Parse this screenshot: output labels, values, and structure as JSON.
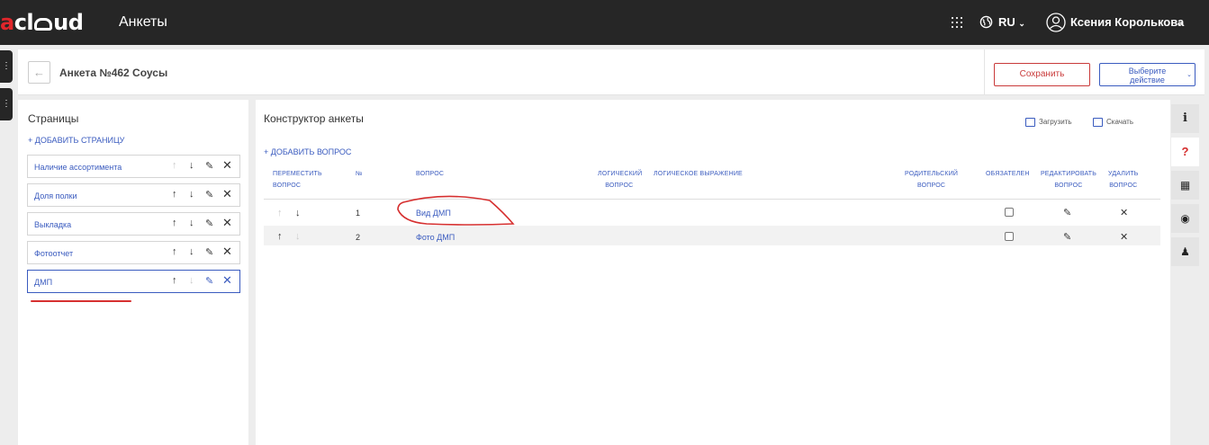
{
  "topbar": {
    "logo_prefix": "a",
    "logo_main": "cl",
    "logo_suffix": "ud",
    "app_title": "Анкеты",
    "lang": "RU",
    "user_name": "Ксения Королькова"
  },
  "header": {
    "form_title": "Анкета №462 Соусы",
    "save_label": "Сохранить",
    "action_label_line1": "Выберите",
    "action_label_line2": "действие"
  },
  "pages": {
    "title": "Страницы",
    "add_label": "+ ДОБАВИТЬ СТРАНИЦУ",
    "items": [
      {
        "label": "Наличие ассортимента"
      },
      {
        "label": "Доля полки"
      },
      {
        "label": "Выкладка"
      },
      {
        "label": "Фотоотчет"
      },
      {
        "label": "ДМП"
      }
    ]
  },
  "constructor": {
    "title": "Конструктор анкеты",
    "upload_label": "Загрузить",
    "download_label": "Скачать",
    "add_question_label": "+ ДОБАВИТЬ ВОПРОС",
    "columns": {
      "move_1": "ПЕРЕМЕСТИТЬ",
      "move_2": "ВОПРОС",
      "num": "№",
      "question": "ВОПРОС",
      "logical_1": "ЛОГИЧЕСКИЙ",
      "logical_2": "ВОПРОС",
      "logical_expr": "ЛОГИЧЕСКОЕ ВЫРАЖЕНИЕ",
      "parent_1": "РОДИТЕЛЬСКИЙ",
      "parent_2": "ВОПРОС",
      "required": "ОБЯЗАТЕЛЕН",
      "edit_1": "РЕДАКТИРОВАТЬ",
      "edit_2": "ВОПРОС",
      "delete_1": "УДАЛИТЬ",
      "delete_2": "ВОПРОС"
    },
    "rows": [
      {
        "num": "1",
        "question": "Вид ДМП",
        "required": false
      },
      {
        "num": "2",
        "question": "Фото ДМП",
        "required": false
      }
    ]
  },
  "colors": {
    "accent": "#3a5bbf",
    "brand_red": "#e0262b",
    "topbar": "#262626"
  }
}
